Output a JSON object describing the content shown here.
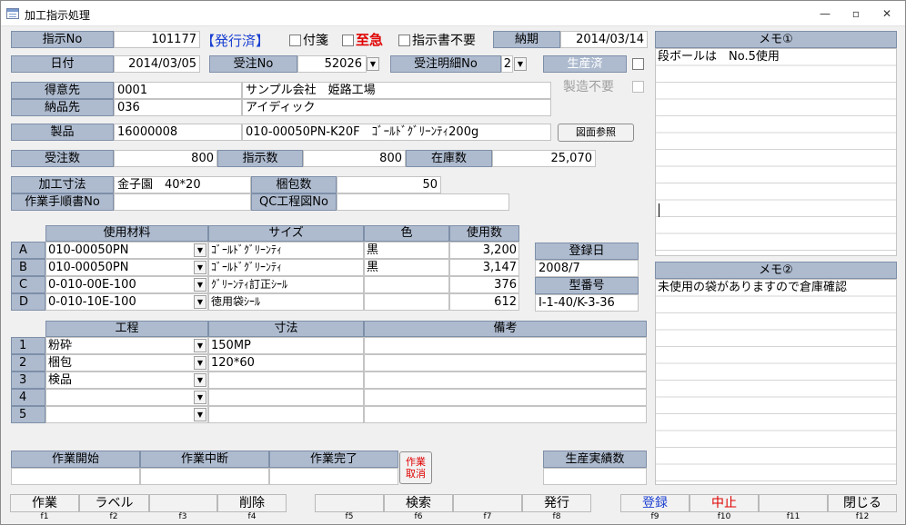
{
  "window": {
    "title": "加工指示処理",
    "min": "—",
    "max": "▫",
    "close": "✕"
  },
  "header": {
    "shiji_no_label": "指示No",
    "shiji_no": "101177",
    "status": "【発行済】",
    "fusen_label": "付箋",
    "shikyu_label": "至急",
    "shijisho_fuyo_label": "指示書不要",
    "noki_label": "納期",
    "noki": "2014/03/14",
    "hizuke_label": "日付",
    "hizuke": "2014/03/05",
    "juchu_no_label": "受注No",
    "juchu_no": "52026",
    "juchu_meisai_label": "受注明細No",
    "juchu_meisai": "2",
    "seisanzumi_label": "生産済",
    "seizo_fuyo_label": "製造不要"
  },
  "customer": {
    "tokuisaki_label": "得意先",
    "tokuisaki_code": "0001",
    "tokuisaki_name": "サンプル会社　姫路工場",
    "nohinsaki_label": "納品先",
    "nohinsaki_code": "036",
    "nohinsaki_name": "アイディック"
  },
  "product": {
    "label": "製品",
    "code": "16000008",
    "name": "010-00050PN-K20F　ｺﾞｰﾙﾄﾞｸﾞﾘｰﾝﾃｨ200g",
    "drawing_button": "図面参照"
  },
  "quantities": {
    "juchu_label": "受注数",
    "juchu": "800",
    "shiji_label": "指示数",
    "shiji": "800",
    "zaiko_label": "在庫数",
    "zaiko": "25,070"
  },
  "process_info": {
    "kako_sunpo_label": "加工寸法",
    "kako_sunpo": "金子園　40*20",
    "konpo_label": "梱包数",
    "konpo": "50",
    "sagyo_tejun_label": "作業手順書No",
    "sagyo_tejun": "",
    "qc_label": "QC工程図No",
    "qc": ""
  },
  "materials": {
    "headers": [
      "使用材料",
      "サイズ",
      "色",
      "使用数"
    ],
    "rows": [
      {
        "key": "A",
        "material": "010-00050PN",
        "size": "ｺﾞｰﾙﾄﾞｸﾞﾘｰﾝﾃｨ",
        "color": "黒",
        "qty": "3,200"
      },
      {
        "key": "B",
        "material": "010-00050PN",
        "size": "ｺﾞｰﾙﾄﾞｸﾞﾘｰﾝﾃｨ",
        "color": "黒",
        "qty": "3,147"
      },
      {
        "key": "C",
        "material": "0-010-00E-100",
        "size": "ｸﾞﾘｰﾝﾃｨ訂正ｼｰﾙ",
        "color": "",
        "qty": "376"
      },
      {
        "key": "D",
        "material": "0-010-10E-100",
        "size": "徳用袋ｼｰﾙ",
        "color": "",
        "qty": "612"
      }
    ]
  },
  "registration": {
    "toroku_label": "登録日",
    "toroku": "2008/7",
    "kataban_label": "型番号",
    "kataban": "I-1-40/K-3-36"
  },
  "steps": {
    "headers": [
      "工程",
      "寸法",
      "備考"
    ],
    "rows": [
      {
        "key": "1",
        "step": "粉砕",
        "size": "150MP",
        "note": ""
      },
      {
        "key": "2",
        "step": "梱包",
        "size": "120*60",
        "note": ""
      },
      {
        "key": "3",
        "step": "検品",
        "size": "",
        "note": ""
      },
      {
        "key": "4",
        "step": "",
        "size": "",
        "note": ""
      },
      {
        "key": "5",
        "step": "",
        "size": "",
        "note": ""
      }
    ]
  },
  "work": {
    "start_label": "作業開始",
    "pause_label": "作業中断",
    "done_label": "作業完了",
    "cancel_l1": "作業",
    "cancel_l2": "取消",
    "seisan_jisseki_label": "生産実績数"
  },
  "memo1": {
    "label": "メモ①",
    "text": "段ボールは　No.5使用"
  },
  "memo2": {
    "label": "メモ②",
    "text": "未使用の袋がありますので倉庫確認"
  },
  "fkeys": [
    {
      "label": "作業",
      "num": "f1"
    },
    {
      "label": "ラベル",
      "num": "f2"
    },
    {
      "label": "",
      "num": "f3"
    },
    {
      "label": "削除",
      "num": "f4"
    },
    {
      "label": "",
      "num": "f5"
    },
    {
      "label": "検索",
      "num": "f6"
    },
    {
      "label": "",
      "num": "f7"
    },
    {
      "label": "発行",
      "num": "f8"
    },
    {
      "label": "登録",
      "num": "f9"
    },
    {
      "label": "中止",
      "num": "f10"
    },
    {
      "label": "",
      "num": "f11"
    },
    {
      "label": "閉じる",
      "num": "f12"
    }
  ],
  "colors": {
    "label_bg": "#aebbcf",
    "status_blue": "#1a3fd1",
    "urgent_red": "#e00000"
  }
}
